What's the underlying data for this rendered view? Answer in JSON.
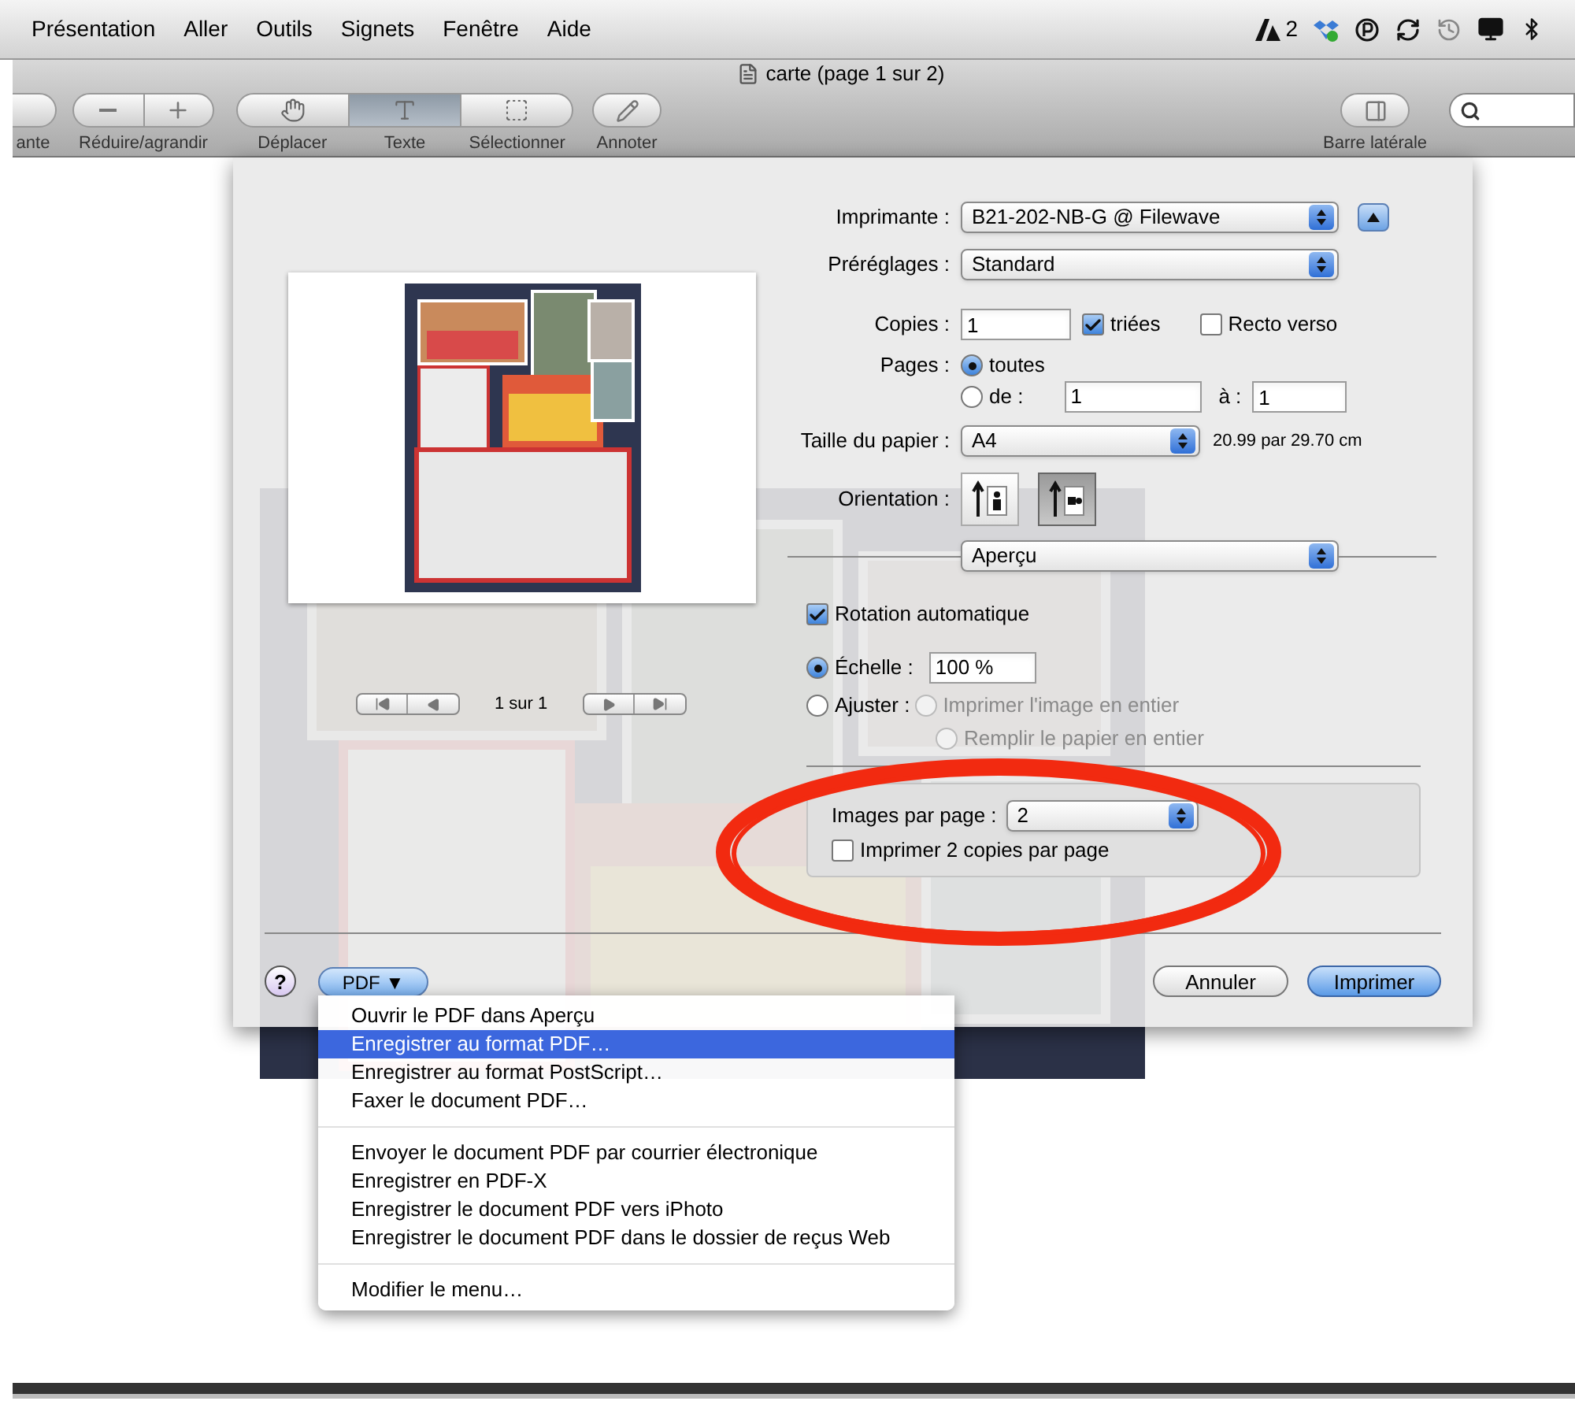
{
  "menu_bar": {
    "items": [
      "Présentation",
      "Aller",
      "Outils",
      "Signets",
      "Fenêtre",
      "Aide"
    ],
    "status_count": "2"
  },
  "window": {
    "title": "carte (page 1 sur 2)",
    "toolbar": {
      "partial_label": "ante",
      "zoom_label": "Réduire/agrandir",
      "tools": [
        {
          "kind": "move",
          "label": "Déplacer",
          "selected": false
        },
        {
          "kind": "text",
          "label": "Texte",
          "selected": true
        },
        {
          "kind": "select",
          "label": "Sélectionner",
          "selected": false
        }
      ],
      "annotate_label": "Annoter",
      "sidebar_label": "Barre latérale"
    }
  },
  "print_dialog": {
    "preview": {
      "page_label": "1 sur 1"
    },
    "printer": {
      "label": "Imprimante :",
      "value": "B21-202-NB-G @ Filewave"
    },
    "presets": {
      "label": "Préréglages :",
      "value": "Standard"
    },
    "copies": {
      "label": "Copies :",
      "value": "1",
      "collated": {
        "label": "triées",
        "checked": true
      },
      "two_sided": {
        "label": "Recto verso",
        "checked": false
      }
    },
    "pages": {
      "label": "Pages :",
      "options": [
        {
          "label": "toutes",
          "selected": true
        },
        {
          "label": "de :",
          "selected": false
        }
      ],
      "from": "1",
      "to_label": "à :",
      "to": "1"
    },
    "paper_size": {
      "label": "Taille du papier :",
      "value": "A4",
      "dimensions": "20.99 par 29.70 cm"
    },
    "orientation": {
      "label": "Orientation :",
      "options": [
        {
          "kind": "portrait",
          "selected": false
        },
        {
          "kind": "landscape",
          "selected": true
        }
      ]
    },
    "panel": {
      "value": "Aperçu"
    },
    "auto_rotate": {
      "label": "Rotation automatique",
      "checked": true
    },
    "scale_options": [
      {
        "label": "Échelle :",
        "selected": true
      },
      {
        "label": "Ajuster :",
        "selected": false
      }
    ],
    "scale_value": "100 %",
    "fit_options": [
      {
        "label": "Imprimer l'image en entier",
        "selected": false,
        "disabled": true
      },
      {
        "label": "Remplir le papier en entier",
        "selected": false,
        "disabled": true
      }
    ],
    "layout": {
      "images_label": "Images par page :",
      "images_value": "2",
      "two_copies": {
        "label": "Imprimer 2 copies par page",
        "checked": false
      }
    },
    "buttons": {
      "help": "?",
      "pdf": "PDF ▼",
      "cancel": "Annuler",
      "print": "Imprimer"
    }
  },
  "pdf_menu": {
    "sections": [
      [
        {
          "label": "Ouvrir le PDF dans Aperçu",
          "selected": false
        },
        {
          "label": "Enregistrer au format PDF…",
          "selected": true
        },
        {
          "label": "Enregistrer au format PostScript…",
          "selected": false
        },
        {
          "label": "Faxer le document PDF…",
          "selected": false
        }
      ],
      [
        {
          "label": "Envoyer le document PDF par courrier électronique",
          "selected": false
        },
        {
          "label": "Enregistrer en PDF-X",
          "selected": false
        },
        {
          "label": "Enregistrer le document PDF vers iPhoto",
          "selected": false
        },
        {
          "label": "Enregistrer le document PDF dans le dossier de reçus Web",
          "selected": false
        }
      ],
      [
        {
          "label": "Modifier le menu…",
          "selected": false
        }
      ]
    ]
  }
}
